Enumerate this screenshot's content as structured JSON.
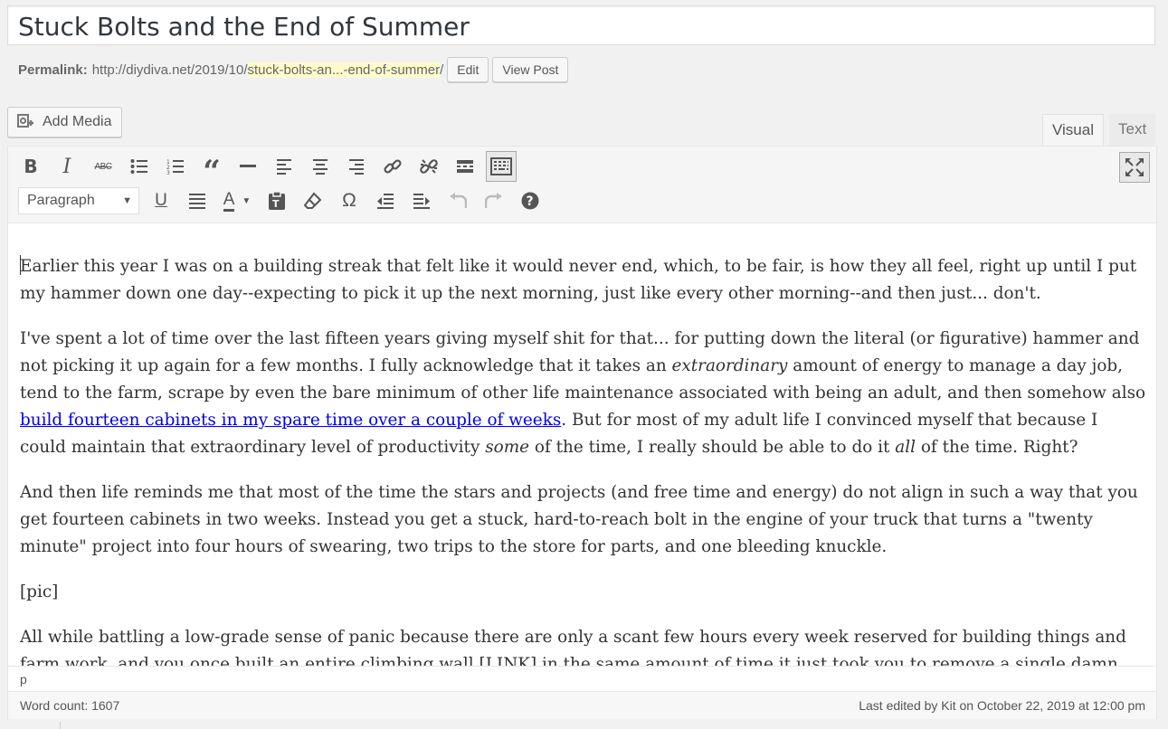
{
  "post": {
    "title": "Stuck Bolts and the End of Summer"
  },
  "permalink": {
    "label": "Permalink:",
    "base": "http://diydiva.net/2019/10/",
    "slug": "stuck-bolts-an...-end-of-summer",
    "trail": "/",
    "edit_label": "Edit",
    "view_label": "View Post"
  },
  "media": {
    "add_label": "Add Media"
  },
  "tabs": {
    "visual": "Visual",
    "text": "Text"
  },
  "toolbar": {
    "format_value": "Paragraph",
    "row1_icons": [
      "bold-icon",
      "italic-icon",
      "strikethrough-icon",
      "bulleted-list-icon",
      "numbered-list-icon",
      "blockquote-icon",
      "horizontal-line-icon",
      "align-left-icon",
      "align-center-icon",
      "align-right-icon",
      "insert-link-icon",
      "remove-link-icon",
      "read-more-icon",
      "toolbar-toggle-icon"
    ],
    "row2_icons": [
      "underline-icon",
      "justify-icon",
      "text-color-icon",
      "paste-as-text-icon",
      "clear-formatting-icon",
      "special-character-icon",
      "decrease-indent-icon",
      "increase-indent-icon",
      "undo-icon",
      "redo-icon",
      "help-icon",
      "fullscreen-icon"
    ]
  },
  "content": {
    "p1": "arlier this year I was on a building streak that felt like it would never end, which, to be fair, is how they all feel, right up until I put my hammer down one day--expecting to pick it up the next morning, just like every other morning--and then just... don't.",
    "p1_first": "E",
    "p2a": "I've spent a lot of time over the last fifteen years giving myself shit for that... for putting down the literal (or figurative) hammer and not picking it up again for a few months. I fully acknowledge that it takes an ",
    "p2_em1": "extraordinary",
    "p2b": " amount of energy to manage a day job, tend to the farm, scrape by even the bare minimum of other life maintenance associated with being an adult, and then somehow also ",
    "p2_link": "build fourteen cabinets in my spare time over a couple of weeks",
    "p2c": ". But for most of my adult life I convinced myself that because I could maintain that extraordinary level of productivity ",
    "p2_em2": "some",
    "p2d": " of the time, I really should be able to do it ",
    "p2_em3": "all",
    "p2e": " of the time. Right?",
    "p3": "And then life reminds me that most of the time the stars and projects (and free time and energy) do not align in such a way that you get fourteen cabinets in two weeks. Instead you get a stuck, hard-to-reach bolt in the engine of your truck that turns a \"twenty minute\" project into four hours of swearing, two trips to the store for parts, and one bleeding knuckle.",
    "p4": "[pic]",
    "p5": "All while battling a low-grade sense of panic because there are only a scant few hours every week reserved for building things and farm work, and you once built an entire climbing wall [LINK] in the same amount of time it just took you to remove a single damn bolt from the engine"
  },
  "footer": {
    "path": "p",
    "word_count": "Word count: 1607",
    "last_edited": "Last edited by Kit on October 22, 2019 at 12:00 pm"
  }
}
